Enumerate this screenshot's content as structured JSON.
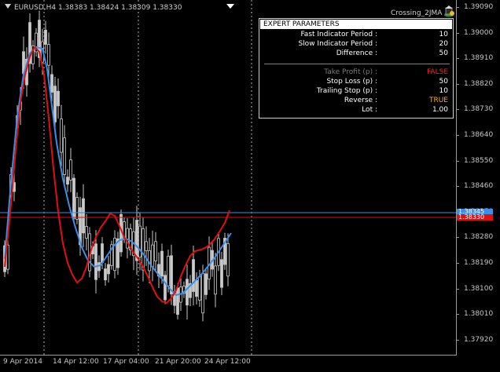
{
  "header": {
    "symbol_line": "EURUSD,H4  1.38383  1.38424  1.38309  1.38330",
    "expert_name": "Crossing_2JMA"
  },
  "price_axis": {
    "labels": [
      "1.39090",
      "1.39000",
      "1.38910",
      "1.38820",
      "1.38730",
      "1.38640",
      "1.38550",
      "1.38460",
      "1.38370",
      "1.38280",
      "1.38190",
      "1.38100",
      "1.38010",
      "1.37920"
    ],
    "blue_tag": "1.38345",
    "red_tag": "1.38330"
  },
  "time_axis": {
    "labels": [
      "9 Apr 2014",
      "14 Apr 12:00",
      "17 Apr 04:00",
      "21 Apr 20:00",
      "24 Apr 12:00"
    ]
  },
  "panel": {
    "title": "EXPERT  PARAMETERS",
    "rows": [
      {
        "label": "Fast Indicator Period :",
        "value": "10"
      },
      {
        "label": "Slow Indicator Period :",
        "value": "20"
      },
      {
        "label": "Difference :",
        "value": "50"
      },
      {
        "label": "Take Profit (p) :",
        "value": "FALSE"
      },
      {
        "label": "Stop Loss (p) :",
        "value": "50"
      },
      {
        "label": "Trailing Stop (p) :",
        "value": "10"
      },
      {
        "label": "Reverse :",
        "value": "TRUE"
      },
      {
        "label": "Lot :",
        "value": "1.00"
      }
    ]
  },
  "colors": {
    "fast_line": "#e01010",
    "slow_line": "#3a8fe8",
    "candles": "#c8c8c8",
    "disabled_label": "#7a7a7a",
    "false_value": "#ff2020",
    "true_value": "#f0b030",
    "separator": "#3cb43c"
  },
  "chart_data": {
    "type": "line",
    "series": [],
    "x": [
      "9 Apr 2014",
      "14 Apr 12:00",
      "17 Apr 04:00",
      "21 Apr 20:00",
      "24 Apr 12:00"
    ],
    "ylim": [
      1.3788,
      1.3912
    ],
    "grid": false
  }
}
